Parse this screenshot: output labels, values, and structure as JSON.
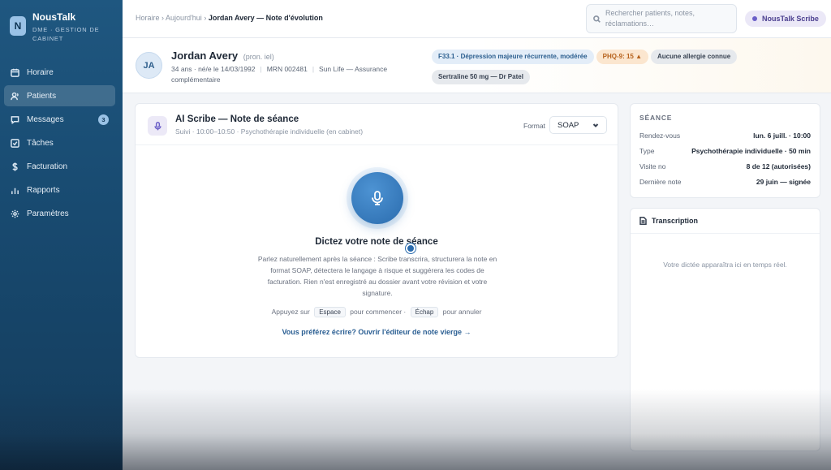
{
  "app": {
    "logo_letter": "N",
    "name": "NousTalk",
    "subtitle": "DME · GESTION DE CABINET"
  },
  "sidebar": {
    "items": [
      {
        "label": "Horaire",
        "icon": "calendar-icon"
      },
      {
        "label": "Patients",
        "icon": "user-icon",
        "active": true
      },
      {
        "label": "Messages",
        "icon": "message-icon",
        "badge": "3"
      },
      {
        "label": "Tâches",
        "icon": "checkbox-icon"
      },
      {
        "label": "Facturation",
        "icon": "dollar-icon"
      },
      {
        "label": "Rapports",
        "icon": "bar-chart-icon"
      },
      {
        "label": "Paramètres",
        "icon": "gear-icon"
      }
    ]
  },
  "topbar": {
    "crumb_1": "Horaire",
    "crumb_2": "Aujourd'hui",
    "crumb_current": "Jordan Avery — Note d'évolution",
    "separator": "›",
    "search_placeholder": "Rechercher patients, notes, réclamations…",
    "scribe_label": "NousTalk Scribe"
  },
  "patient": {
    "initials": "JA",
    "name": "Jordan Avery",
    "pronouns": "(pron. iel)",
    "age_birth": "34 ans · né/e le 14/03/1992",
    "mrn": "MRN 002481",
    "insurance": "Sun Life — Assurance complémentaire",
    "tags": {
      "diagnosis": "F33.1 · Dépression majeure récurrente, modérée",
      "phq": "PHQ-9: 15 ▲",
      "allergy": "Aucune allergie connue",
      "medication": "Sertraline 50 mg — Dr Patel"
    }
  },
  "scribe": {
    "title": "AI Scribe — Note de séance",
    "subtitle": "Suivi · 10:00–10:50 · Psychothérapie individuelle (en cabinet)",
    "format_label": "Format",
    "format_value": "SOAP",
    "dictate_title": "Dictez votre note de séance",
    "dictate_desc": "Parlez naturellement après la séance : Scribe transcrira, structurera la note en format SOAP, détectera le langage à risque et suggérera les codes de facturation. Rien n'est enregistré au dossier avant votre révision et votre signature.",
    "shortcut_prefix": "Appuyez sur",
    "key_start": "Espace",
    "shortcut_mid": "pour commencer ·",
    "key_cancel": "Échap",
    "shortcut_suffix": "pour annuler",
    "blank_editor_link": "Vous préférez écrire? Ouvrir l'éditeur de note vierge →"
  },
  "session": {
    "heading": "SÉANCE",
    "rows": [
      {
        "k": "Rendez-vous",
        "v": "lun. 6 juill. · 10:00"
      },
      {
        "k": "Type",
        "v": "Psychothérapie individuelle · 50 min"
      },
      {
        "k": "Visite no",
        "v": "8 de 12 (autorisées)"
      },
      {
        "k": "Dernière note",
        "v": "29 juin — signée"
      }
    ]
  },
  "transcription": {
    "heading": "Transcription",
    "empty_text": "Votre dictée apparaîtra ici en temps réel."
  },
  "colors": {
    "sidebar": "#1f5780",
    "accent": "#2b6cae",
    "scribe_purple": "#6b5fc8",
    "phq_orange": "#b6611b"
  }
}
